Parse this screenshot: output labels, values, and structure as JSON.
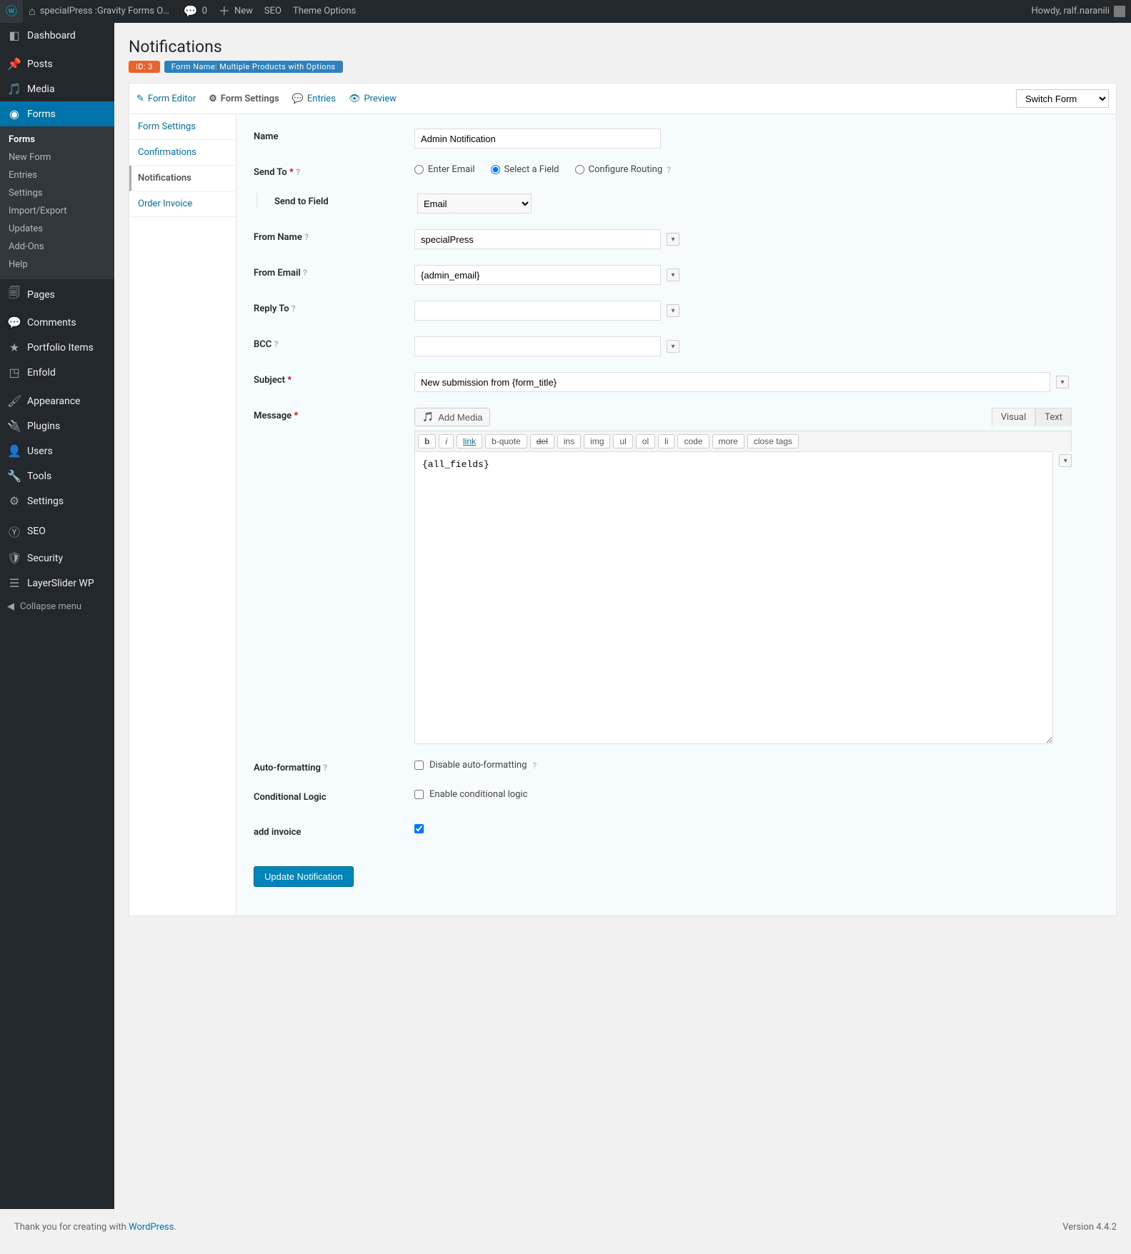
{
  "adminbar": {
    "site_name": "specialPress :Gravity Forms Order Invoic...",
    "comments_count": "0",
    "new_label": "New",
    "seo_label": "SEO",
    "theme_options_label": "Theme Options",
    "howdy": "Howdy, ralf.naranili"
  },
  "adminmenu": {
    "dashboard": "Dashboard",
    "posts": "Posts",
    "media": "Media",
    "forms": "Forms",
    "forms_sub": {
      "forms": "Forms",
      "new_form": "New Form",
      "entries": "Entries",
      "settings": "Settings",
      "import_export": "Import/Export",
      "updates": "Updates",
      "addons": "Add-Ons",
      "help": "Help"
    },
    "pages": "Pages",
    "comments": "Comments",
    "portfolio": "Portfolio Items",
    "enfold": "Enfold",
    "appearance": "Appearance",
    "plugins": "Plugins",
    "users": "Users",
    "tools": "Tools",
    "settings": "Settings",
    "seo": "SEO",
    "security": "Security",
    "layerslider": "LayerSlider WP",
    "collapse": "Collapse menu"
  },
  "page": {
    "title": "Notifications",
    "id_badge": "ID: 3",
    "form_name_badge": "Form Name: Multiple Products with Options"
  },
  "toolbar": {
    "form_editor": "Form Editor",
    "form_settings": "Form Settings",
    "entries": "Entries",
    "preview": "Preview",
    "switch_form": "Switch Form"
  },
  "side_tabs": {
    "form_settings": "Form Settings",
    "confirmations": "Confirmations",
    "notifications": "Notifications",
    "order_invoice": "Order Invoice"
  },
  "labels": {
    "name": "Name",
    "send_to": "Send To",
    "send_to_field": "Send to Field",
    "from_name": "From Name",
    "from_email": "From Email",
    "reply_to": "Reply To",
    "bcc": "BCC",
    "subject": "Subject",
    "message": "Message",
    "auto_formatting": "Auto-formatting",
    "conditional_logic": "Conditional Logic",
    "add_invoice": "add invoice"
  },
  "send_to_options": {
    "enter_email": "Enter Email",
    "select_field": "Select a Field",
    "configure_routing": "Configure Routing"
  },
  "values": {
    "name": "Admin Notification",
    "send_to_field_select": "Email",
    "from_name": "specialPress",
    "from_email": "{admin_email}",
    "reply_to": "",
    "bcc": "",
    "subject": "New submission from {form_title}",
    "message": "{all_fields}"
  },
  "editor": {
    "add_media": "Add Media",
    "tab_visual": "Visual",
    "tab_text": "Text",
    "qt": {
      "b": "b",
      "i": "i",
      "link": "link",
      "bquote": "b-quote",
      "del": "del",
      "ins": "ins",
      "img": "img",
      "ul": "ul",
      "ol": "ol",
      "li": "li",
      "code": "code",
      "more": "more",
      "close": "close tags"
    }
  },
  "checkboxes": {
    "disable_autoformat": "Disable auto-formatting",
    "enable_conditional": "Enable conditional logic"
  },
  "buttons": {
    "update": "Update Notification"
  },
  "footer": {
    "thanks_pre": "Thank you for creating with ",
    "wordpress": "WordPress",
    "version": "Version 4.4.2"
  }
}
